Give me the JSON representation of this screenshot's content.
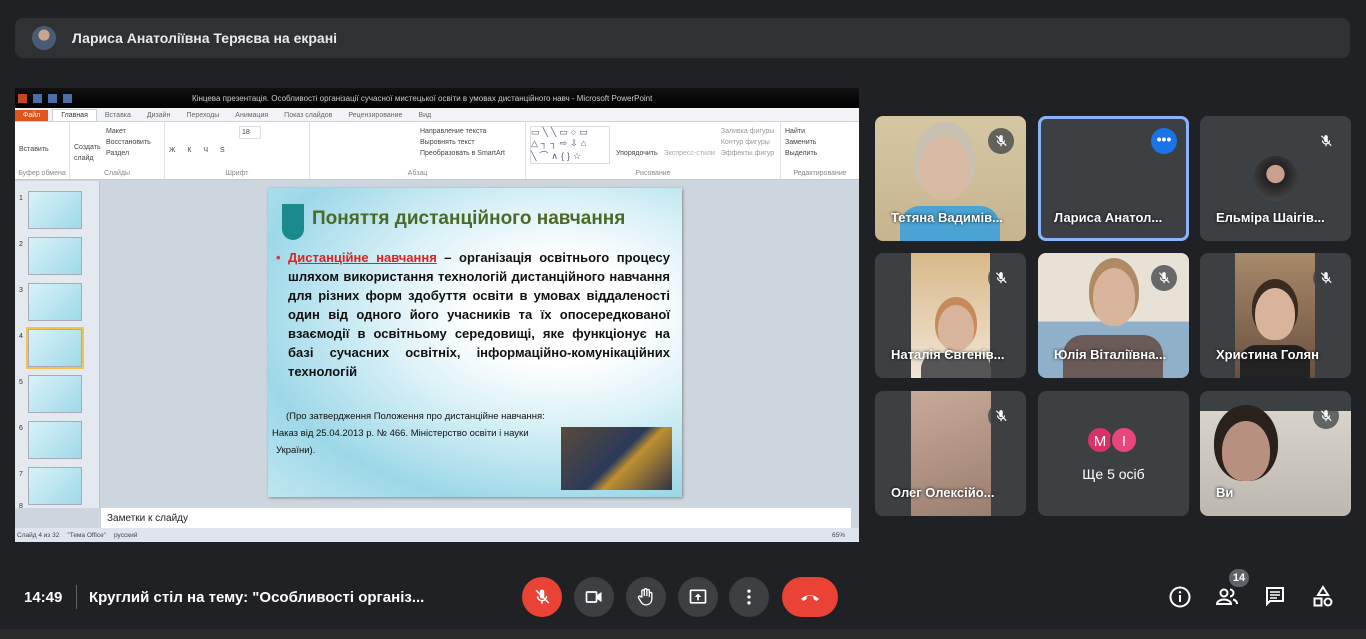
{
  "banner": {
    "text": "Лариса Анатоліївна Теряєва на екрані"
  },
  "ppt": {
    "window_title": "Кінцева презентація. Особливості організації сучасної мистецької освіти в умовах дистанційного навч  -  Microsoft PowerPoint",
    "tabs": [
      "Файл",
      "Главная",
      "Вставка",
      "Дизайн",
      "Переходы",
      "Анимация",
      "Показ слайдов",
      "Рецензирование",
      "Вид"
    ],
    "active_tab": "Главная",
    "ribbon": {
      "clipboard": {
        "paste": "Вставить",
        "label": "Буфер обмена"
      },
      "slides": {
        "new_slide": "Создать слайд",
        "layout": "Макет",
        "reset": "Восстановить",
        "section": "Раздел",
        "label": "Слайды"
      },
      "font": {
        "size": "18",
        "label": "Шрифт"
      },
      "paragraph": {
        "text_direction": "Направление текста",
        "align_text": "Выровнять текст",
        "smartart": "Преобразовать в SmartArt",
        "label": "Абзац"
      },
      "drawing": {
        "arrange": "Упорядочить",
        "quick_styles": "Экспресс-стили",
        "fill": "Заливка фигуры",
        "outline": "Контур фигуры",
        "effects": "Эффекты фигур",
        "label": "Рисование"
      },
      "editing": {
        "find": "Найти",
        "replace": "Заменить",
        "select": "Выделить",
        "label": "Редактирование"
      }
    },
    "thumbnails": [
      "1",
      "2",
      "3",
      "4",
      "5",
      "6",
      "7",
      "8"
    ],
    "selected_slide": 4,
    "slide": {
      "title": "Поняття дистанційного навчання",
      "term": "Дистанційне навчання",
      "body": " – організація освітнього процесу шляхом використання технологій дистанційного навчання для різних форм здобуття освіти в умовах віддаленості один від одного його учасників та їх опосередкованої взаємодії в освітньому середовищі, яке функціонує на базі сучасних освітніх, інформаційно-комунікаційних технологій",
      "ref1": "(Про затвердження Положення про дистанційне навчання:",
      "ref2": "Наказ від 25.04.2013 р. № 466. Міністерство освіти і науки",
      "ref3": "України)."
    },
    "notes_placeholder": "Заметки к слайду",
    "status": {
      "slide": "Слайд 4 из 32",
      "theme": "\"Тема Office\"",
      "lang": "русский",
      "zoom": "65%"
    }
  },
  "participants": [
    {
      "name": "Тетяна Вадимів...",
      "muted": true
    },
    {
      "name": "Лариса Анатол...",
      "muted": false,
      "speaking": true
    },
    {
      "name": "Ельміра Шаігів...",
      "muted": true
    },
    {
      "name": "Наталія Євгенів...",
      "muted": true
    },
    {
      "name": "Юлія Віталіївна...",
      "muted": true
    },
    {
      "name": "Христина Голян",
      "muted": true
    },
    {
      "name": "Олег Олексійо...",
      "muted": true
    },
    {
      "name": "Ще 5 осіб",
      "avatars": [
        "M",
        "I"
      ]
    },
    {
      "name": "Ви",
      "muted": true
    }
  ],
  "bottom": {
    "time": "14:49",
    "meeting_title": "Круглий стіл на тему: \"Особливості організ...",
    "participant_count": "14"
  },
  "colors": {
    "bg": "#202124",
    "red": "#ea4335",
    "accent": "#8ab4f8",
    "more_avatar_m": "#d93267",
    "more_avatar_i": "#e8467c"
  }
}
